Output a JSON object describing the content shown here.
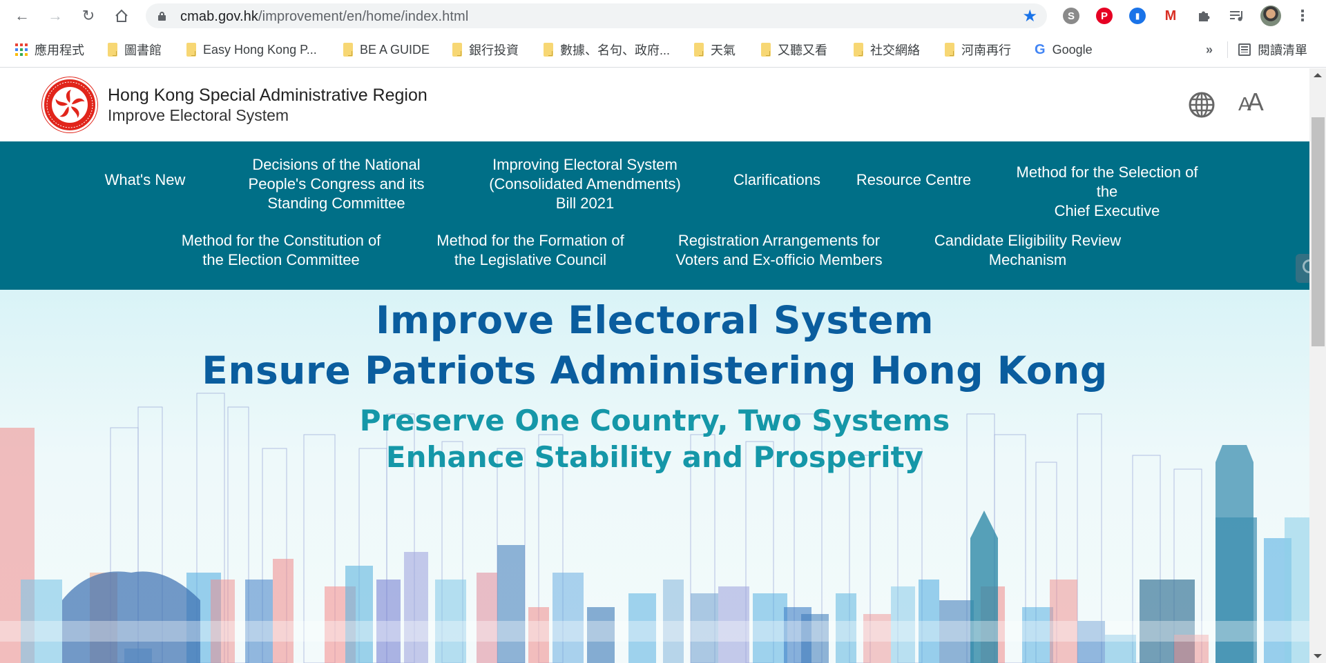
{
  "browser": {
    "url_host": "cmab.gov.hk",
    "url_path": "/improvement/en/home/index.html",
    "nav": {
      "back": "back-arrow-icon",
      "forward": "forward-arrow-icon",
      "reload": "reload-icon",
      "home": "home-icon"
    },
    "extensions": [
      {
        "name": "skype-extension",
        "glyph": "S",
        "color": "#8a8a8a"
      },
      {
        "name": "pinterest-extension",
        "glyph": "P",
        "color": "#e60023"
      },
      {
        "name": "bookmark-extension",
        "glyph": "▮",
        "color": "#1a73e8"
      },
      {
        "name": "gmail-extension",
        "glyph": "M",
        "color": "#d93025"
      }
    ],
    "bookmarks": [
      {
        "label": "應用程式",
        "type": "apps"
      },
      {
        "label": "圖書館",
        "type": "folder"
      },
      {
        "label": "Easy Hong Kong P...",
        "type": "folder"
      },
      {
        "label": "BE A GUIDE",
        "type": "folder"
      },
      {
        "label": "銀行投資",
        "type": "folder"
      },
      {
        "label": "數據、名句、政府...",
        "type": "folder"
      },
      {
        "label": "天氣",
        "type": "folder"
      },
      {
        "label": "又聽又看",
        "type": "folder"
      },
      {
        "label": "社交網絡",
        "type": "folder"
      },
      {
        "label": "河南再行",
        "type": "folder"
      },
      {
        "label": "Google",
        "type": "google"
      }
    ],
    "overflow": "»",
    "reading_list": "閱讀清單"
  },
  "site": {
    "title": "Hong Kong Special Administrative Region",
    "subtitle": "Improve Electoral System",
    "language_icon": "globe-icon",
    "font_size_label": "A",
    "font_size_label_large": "A",
    "nav_color": "#006f87",
    "nav": [
      {
        "label": "What's New"
      },
      {
        "label": "Decisions of the National\nPeople's Congress and its\nStanding Committee"
      },
      {
        "label": "Improving Electoral System\n(Consolidated Amendments)\nBill 2021"
      },
      {
        "label": "Clarifications"
      },
      {
        "label": "Resource Centre"
      },
      {
        "label": "Method for the Selection of the\nChief Executive"
      },
      {
        "label": "Method for the Constitution of\nthe Election Committee"
      },
      {
        "label": "Method for the Formation of\nthe Legislative Council"
      },
      {
        "label": "Registration Arrangements for\nVoters and Ex-officio Members"
      },
      {
        "label": "Candidate Eligibility Review\nMechanism"
      }
    ]
  },
  "banner": {
    "line1": "Improve Electoral System",
    "line2": "Ensure Patriots Administering Hong Kong",
    "line3": "Preserve One Country, Two Systems",
    "line4": "Enhance Stability and Prosperity",
    "colors": {
      "primary": "#0a5d9e",
      "secondary": "#1597a8"
    }
  }
}
